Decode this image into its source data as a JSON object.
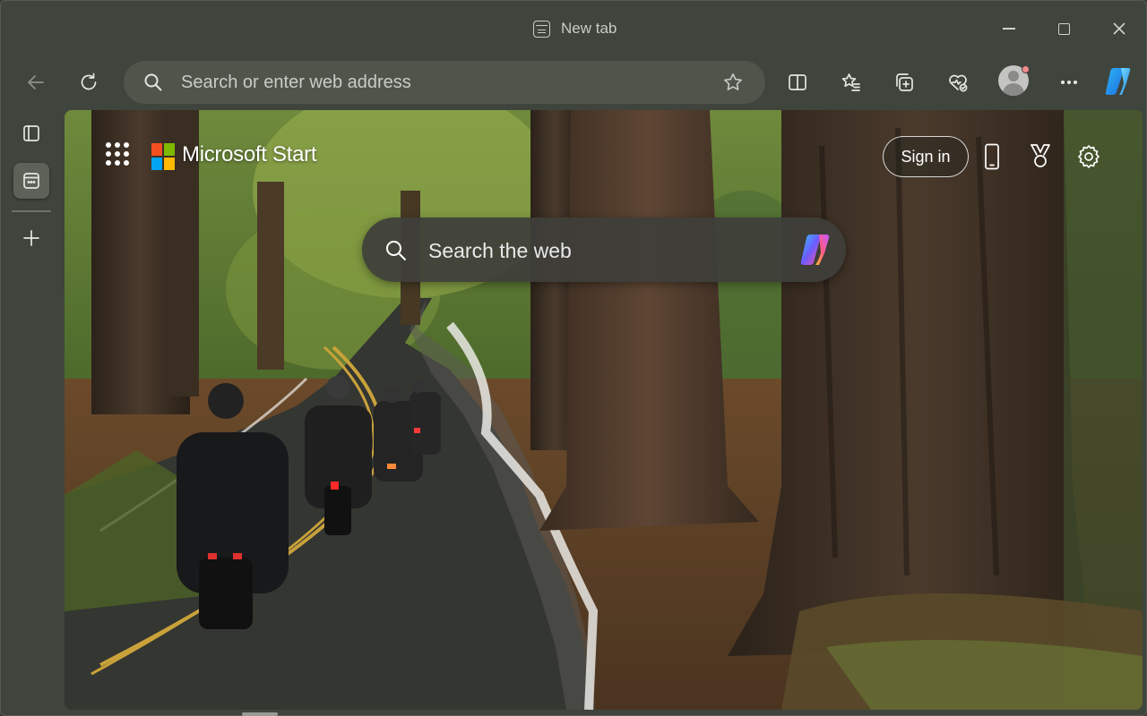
{
  "window": {
    "title": "New tab",
    "controls": [
      "minimize",
      "maximize",
      "close"
    ]
  },
  "toolbar": {
    "address_placeholder": "Search or enter web address",
    "icons": [
      "back-arrow-icon",
      "refresh-icon",
      "search-icon",
      "star-icon",
      "split-screen-icon",
      "favorites-icon",
      "collections-icon",
      "browser-essentials-icon",
      "profile-avatar",
      "more-icon",
      "copilot-icon"
    ]
  },
  "sidebar": {
    "items": [
      {
        "icon": "tab-actions-icon"
      },
      {
        "icon": "new-tab-icon",
        "active": true
      },
      {
        "icon": "plus-icon"
      }
    ]
  },
  "page": {
    "brand": "Microsoft Start",
    "sign_in": "Sign in",
    "search_placeholder": "Search the web",
    "icons": [
      "apps-grid-icon",
      "microsoft-logo",
      "phone-icon",
      "trophy-icon",
      "gear-icon",
      "copilot-icon"
    ]
  },
  "colors": {
    "frame": "#3f443c",
    "address_bar": "#50554b",
    "search_box": "#3e3e3a",
    "ms_red": "#f25022",
    "ms_green": "#7fba00",
    "ms_blue": "#00a4ef",
    "ms_yellow": "#ffb900"
  }
}
